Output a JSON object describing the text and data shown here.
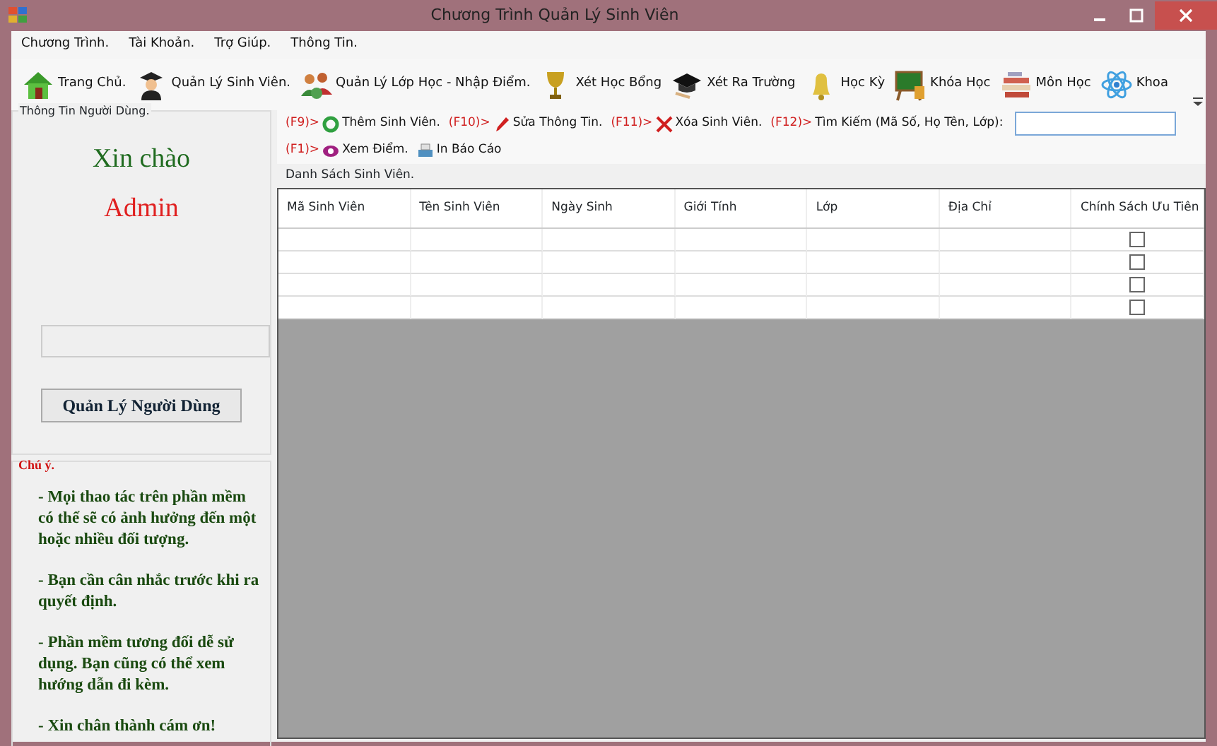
{
  "window": {
    "title": "Chương Trình Quản Lý Sinh Viên"
  },
  "menu": [
    "Chương Trình.",
    "Tài Khoản.",
    "Trợ Giúp.",
    "Thông Tin."
  ],
  "toolbar": [
    "Trang Chủ.",
    "Quản Lý Sinh Viên.",
    "Quản Lý Lớp Học - Nhập Điểm.",
    "Xét Học Bổng",
    "Xét Ra Trường",
    "Học Kỳ",
    "Khóa Học",
    "Môn Học",
    "Khoa"
  ],
  "user_panel": {
    "title": "Thông Tin Người Dùng.",
    "greeting": "Xin chào",
    "username": "Admin",
    "button": "Quản Lý Người Dùng"
  },
  "note": {
    "title": "Chú ý.",
    "paragraphs": [
      "- Mọi thao tác trên phần mềm có thể sẽ có ảnh hưởng đến một hoặc nhiều đối tượng.",
      "- Bạn cần cân nhắc trước khi ra quyết định.",
      "- Phần mềm tương đối dễ sử dụng. Bạn cũng có thể xem hướng dẫn đi kèm.",
      "- Xin chân thành cám ơn!"
    ]
  },
  "actions": [
    [
      {
        "key": "(F9)>",
        "label": "Thêm Sinh Viên."
      },
      {
        "key": "(F10)>",
        "label": "Sửa Thông Tin."
      },
      {
        "key": "(F11)>",
        "label": "Xóa Sinh Viên."
      },
      {
        "key": "(F12)>",
        "label": "Tìm Kiếm (Mã Số, Họ Tên, Lớp):"
      }
    ],
    [
      {
        "key": "(F1)>",
        "label": "Xem Điểm."
      },
      {
        "label": "In Báo Cáo"
      }
    ]
  ],
  "table": {
    "title": "Danh Sách Sinh Viên.",
    "columns": [
      "Mã Sinh Viên",
      "Tên Sinh Viên",
      "Ngày Sinh",
      "Giới Tính",
      "Lớp",
      "Địa Chỉ",
      "Chính Sách Ưu Tiên"
    ],
    "rows": [
      {
        "checked": false
      },
      {
        "checked": false
      },
      {
        "checked": false
      },
      {
        "checked": false
      }
    ]
  }
}
